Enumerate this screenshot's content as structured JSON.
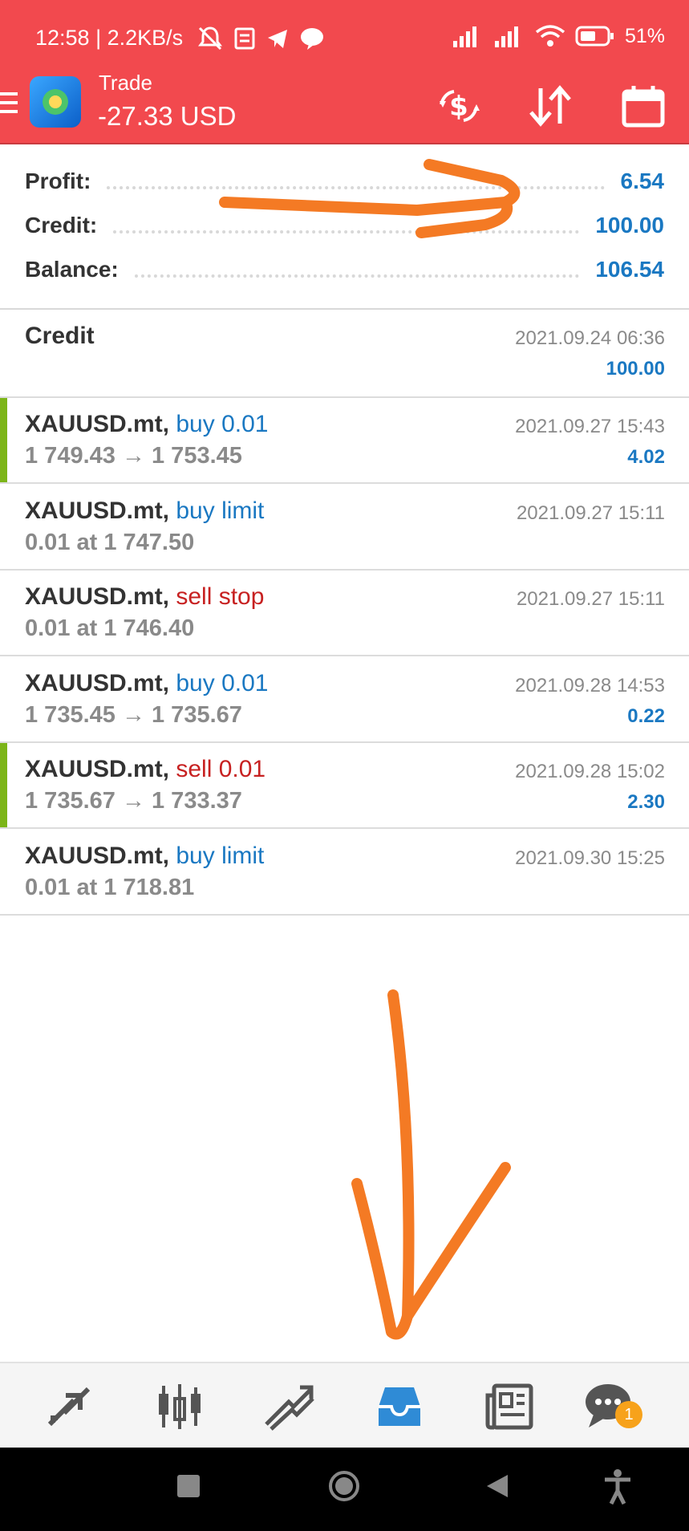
{
  "status_bar": {
    "time": "12:58 | 2.2KB/s",
    "battery": "51%",
    "icons": [
      "bell-off-icon",
      "notes-icon",
      "telegram-icon",
      "line-icon",
      "signal-icon",
      "signal-icon",
      "wifi-icon",
      "battery-icon"
    ]
  },
  "app_bar": {
    "title": "Trade",
    "subtitle": "-27.33 USD",
    "icons": [
      "menu-icon",
      "app-logo",
      "currency-exchange-icon",
      "sort-icon",
      "calendar-icon"
    ]
  },
  "summary": [
    {
      "label": "Profit:",
      "value": "6.54"
    },
    {
      "label": "Credit:",
      "value": "100.00"
    },
    {
      "label": "Balance:",
      "value": "106.54"
    }
  ],
  "credit_row": {
    "title": "Credit",
    "date": "2021.09.24 06:36",
    "amount": "100.00"
  },
  "trades": [
    {
      "symbol": "XAUUSD.mt,",
      "action": "buy 0.01",
      "action_color": "blue",
      "detail": "1 749.43 → 1 753.45",
      "date": "2021.09.27 15:43",
      "amount": "4.02",
      "marker": true
    },
    {
      "symbol": "XAUUSD.mt,",
      "action": "buy limit",
      "action_color": "blue",
      "detail": "0.01 at 1 747.50",
      "date": "2021.09.27 15:11",
      "amount": "",
      "marker": false
    },
    {
      "symbol": "XAUUSD.mt,",
      "action": "sell stop",
      "action_color": "red",
      "detail": "0.01 at 1 746.40",
      "date": "2021.09.27 15:11",
      "amount": "",
      "marker": false
    },
    {
      "symbol": "XAUUSD.mt,",
      "action": "buy 0.01",
      "action_color": "blue",
      "detail": "1 735.45 → 1 735.67",
      "date": "2021.09.28 14:53",
      "amount": "0.22",
      "marker": false
    },
    {
      "symbol": "XAUUSD.mt,",
      "action": "sell 0.01",
      "action_color": "red",
      "detail": "1 735.67 → 1 733.37",
      "date": "2021.09.28 15:02",
      "amount": "2.30",
      "marker": true
    },
    {
      "symbol": "XAUUSD.mt,",
      "action": "buy limit",
      "action_color": "blue",
      "detail": "0.01 at 1 718.81",
      "date": "2021.09.30 15:25",
      "amount": "",
      "marker": false
    }
  ],
  "bottom_nav": {
    "items": [
      "quotes-icon",
      "chart-icon",
      "trade-icon",
      "history-icon",
      "news-icon",
      "messages-icon"
    ],
    "active": "history-icon",
    "badge": "1"
  },
  "colors": {
    "header": "#f2494e",
    "accent": "#1a78c2",
    "sell": "#c72121",
    "marker": "#7cb518",
    "annotation": "#f47a24"
  }
}
